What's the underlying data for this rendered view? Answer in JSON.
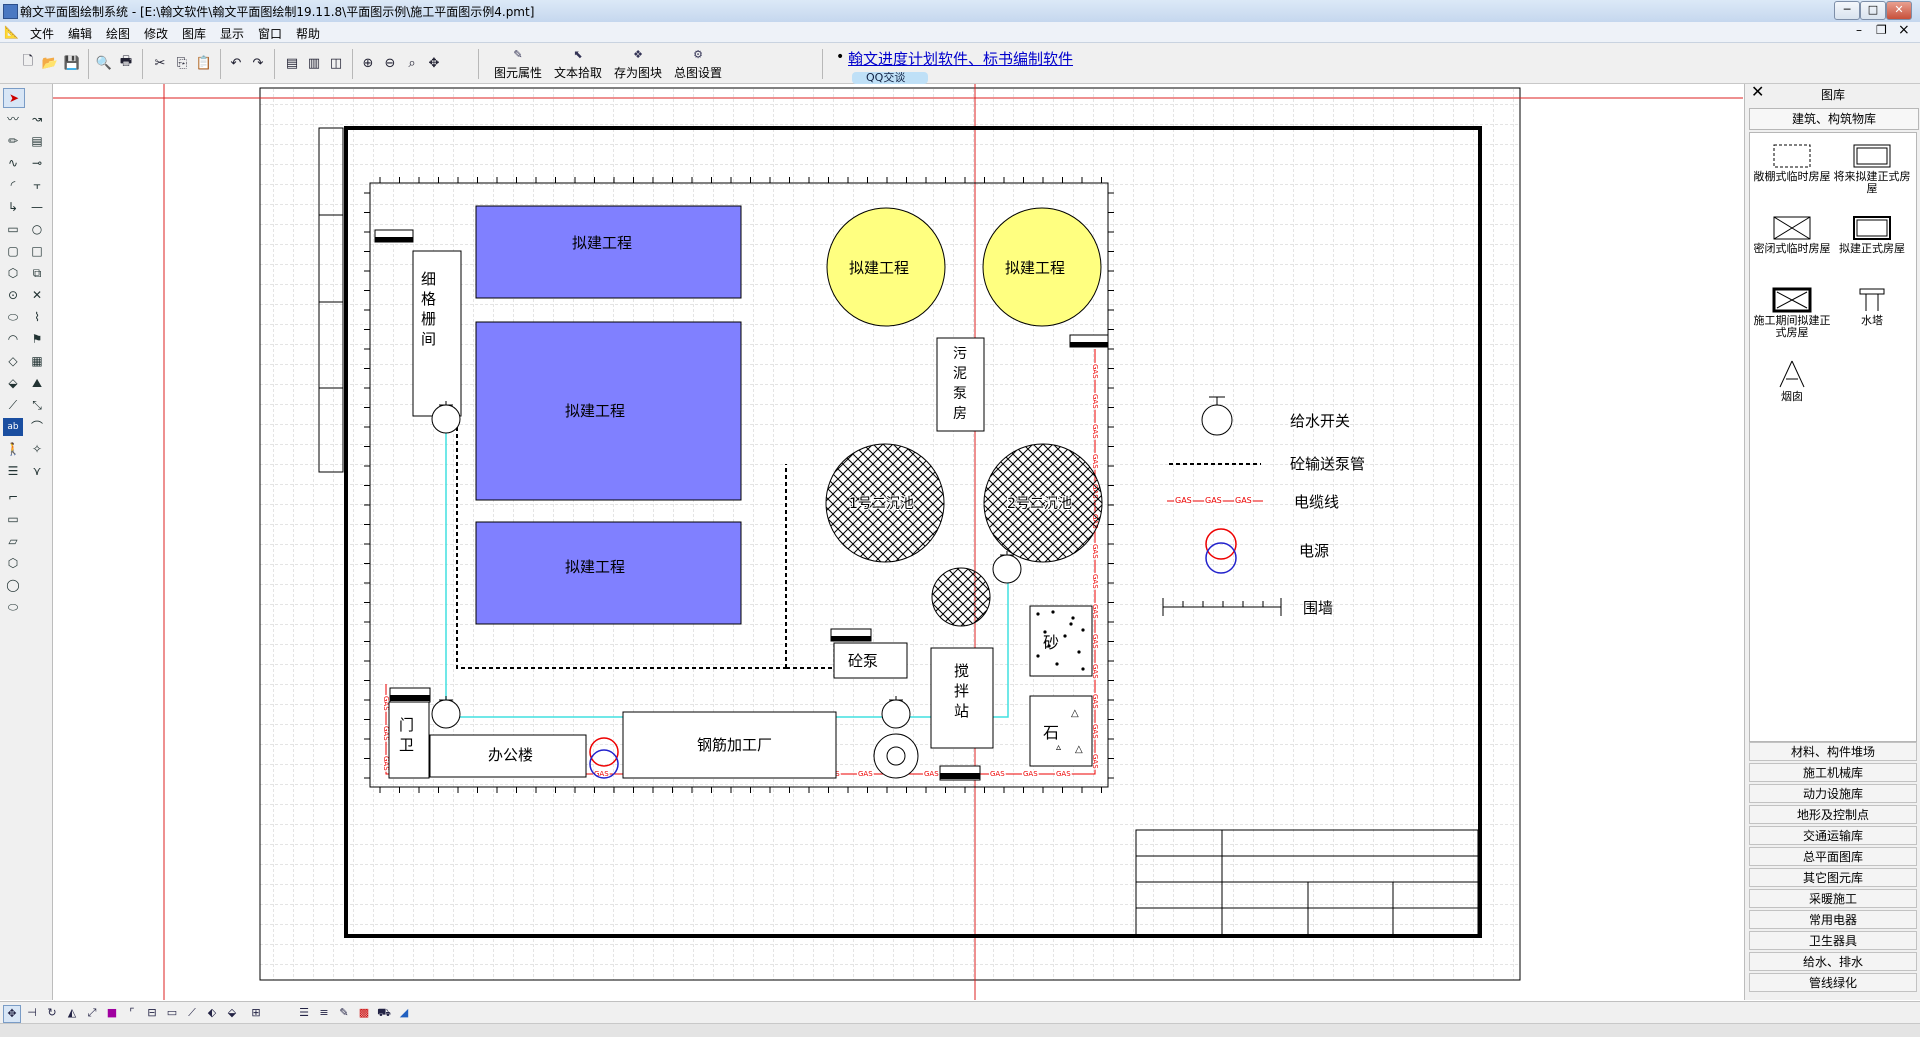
{
  "window": {
    "title": "翰文平面图绘制系统 - [E:\\翰文软件\\翰文平面图绘制19.11.8\\平面图示例\\施工平面图示例4.pmt]",
    "controls": {
      "minimize": "─",
      "maximize": "□",
      "close": "✕"
    },
    "mdi_controls": {
      "minimize": "–",
      "restore": "❐",
      "close": "×"
    }
  },
  "menu": [
    "文件",
    "编辑",
    "绘图",
    "修改",
    "图库",
    "显示",
    "窗口",
    "帮助"
  ],
  "toolbar": {
    "labeled_buttons": [
      {
        "label": "图元属性",
        "icon": "properties-icon"
      },
      {
        "label": "文本拾取",
        "icon": "text-pick-icon"
      },
      {
        "label": "存为图块",
        "icon": "save-block-icon"
      },
      {
        "label": "总图设置",
        "icon": "settings-icon"
      }
    ],
    "ad_link": "翰文进度计划软件、标书编制软件",
    "qq_button": "QQ交谈"
  },
  "drawing": {
    "buildings": [
      "拟建工程",
      "拟建工程",
      "拟建工程"
    ],
    "round_buildings": [
      "拟建工程",
      "拟建工程"
    ],
    "grille": "细格栅间",
    "sludge_pump": "污泥泵房",
    "tanks": [
      "1号二沉池",
      "2号二沉池"
    ],
    "concrete_pump": "砼泵",
    "mixing_station": "搅拌站",
    "sand": "砂",
    "stone": "石",
    "guard": "门卫",
    "office": "办公楼",
    "rebar": "钢筋加工厂",
    "cable_tag": "GAS",
    "legend": [
      {
        "symbol": "water-switch",
        "label": "给水开关"
      },
      {
        "symbol": "pump-pipe",
        "label": "砼输送泵管"
      },
      {
        "symbol": "cable",
        "label": "电缆线"
      },
      {
        "symbol": "power",
        "label": "电源"
      },
      {
        "symbol": "fence",
        "label": "围墙"
      }
    ]
  },
  "library": {
    "title": "图库",
    "close": "✕",
    "category": "建筑、构筑物库",
    "items": [
      {
        "label": "敞棚式临时房屋",
        "icon": "open-shed-icon"
      },
      {
        "label": "将来拟建正式房屋",
        "icon": "future-building-icon"
      },
      {
        "label": "密闭式临时房屋",
        "icon": "closed-temp-house-icon"
      },
      {
        "label": "拟建正式房屋",
        "icon": "planned-building-icon"
      },
      {
        "label": "施工期间拟建正式房屋",
        "icon": "construction-building-icon"
      },
      {
        "label": "水塔",
        "icon": "water-tower-icon"
      },
      {
        "label": "烟囱",
        "icon": "chimney-icon"
      }
    ],
    "categories": [
      "材料、构件堆场",
      "施工机械库",
      "动力设施库",
      "地形及控制点",
      "交通运输库",
      "总平面图库",
      "其它图元库",
      "采暖施工",
      "常用电器",
      "卫生器具",
      "给水、排水",
      "管线绿化"
    ]
  },
  "colors": {
    "building_fill": "#8080ff",
    "round_fill": "#ffff80",
    "water_pipe": "#40e0e0",
    "cable": "#ff0000",
    "grid": "#c8c8c8"
  }
}
